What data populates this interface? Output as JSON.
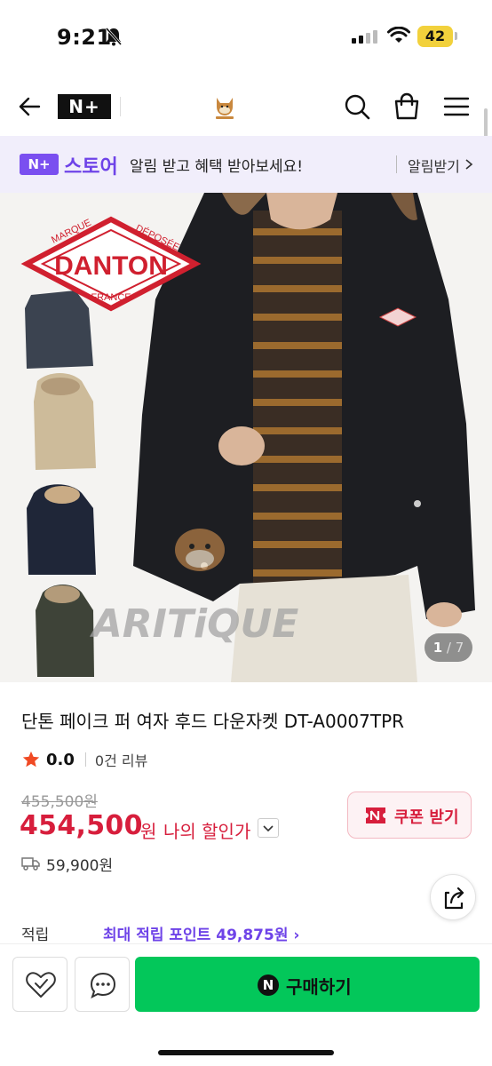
{
  "status_bar": {
    "time": "9:21",
    "battery": "42"
  },
  "nav": {
    "brand_logo": "N+"
  },
  "store_banner": {
    "badge": "N+",
    "store_name": "스토어",
    "message": "알림 받고 혜택 받아보세요!",
    "subscribe_label": "알림받기"
  },
  "gallery": {
    "brand_logo": {
      "arc_top_left": "MARQUE",
      "arc_top_right": "DÉPOSÉE",
      "name": "DANTON",
      "bottom": "FRANCE"
    },
    "watermark": "ARITiQUE",
    "current": "1",
    "total": "/ 7"
  },
  "product": {
    "title": "단톤 페이크 퍼 여자 후드 다운자켓 DT-A0007TPR",
    "rating": "0.0",
    "review_count": "0건 리뷰",
    "original_price": "455,500원",
    "price": "454,500",
    "price_unit": "원",
    "my_discount": "나의 할인가",
    "coupon_label": "쿠폰 받기",
    "shipping_fee": "59,900원",
    "points_label": "적립",
    "points_value": "최대 적립 포인트 49,875원"
  },
  "bottom_bar": {
    "buy_label": "구매하기",
    "buy_badge": "N"
  },
  "colors": {
    "accent_purple": "#6e43e8",
    "price_red": "#d71e3c",
    "buy_green": "#03c75a"
  },
  "icons": [
    "bell-slash-icon",
    "signal-icon",
    "wifi-icon",
    "back-arrow-icon",
    "search-icon",
    "bag-icon",
    "menu-icon",
    "chevron-right-icon",
    "star-icon",
    "chevron-down-icon",
    "truck-icon",
    "share-icon",
    "wishlist-icon",
    "chat-icon"
  ]
}
